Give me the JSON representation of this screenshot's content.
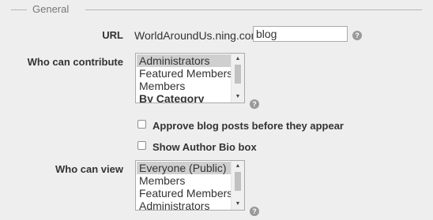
{
  "fieldset": {
    "legend": "General"
  },
  "url": {
    "label": "URL",
    "prefix": "WorldAroundUs.ning.com/",
    "value": "blog",
    "help": "?"
  },
  "contribute": {
    "label": "Who can contribute",
    "options": [
      "Administrators",
      "Featured Members",
      "Members"
    ],
    "group_label": "By Category",
    "selected": "Administrators",
    "help": "?"
  },
  "approve": {
    "label": "Approve blog posts before they appear",
    "checked": false
  },
  "author_bio": {
    "label": "Show Author Bio box",
    "checked": false
  },
  "view": {
    "label": "Who can view",
    "options": [
      "Everyone (Public)",
      "Members",
      "Featured Members",
      "Administrators"
    ],
    "selected": "Everyone (Public)",
    "help": "?"
  },
  "colors": {
    "background": "#eeeeee",
    "selected_option": "#cfcfcf",
    "help_icon": "#999999"
  },
  "icons": {
    "help": "question-circle-icon",
    "scroll_up": "triangle-up-icon",
    "scroll_down": "triangle-down-icon"
  }
}
